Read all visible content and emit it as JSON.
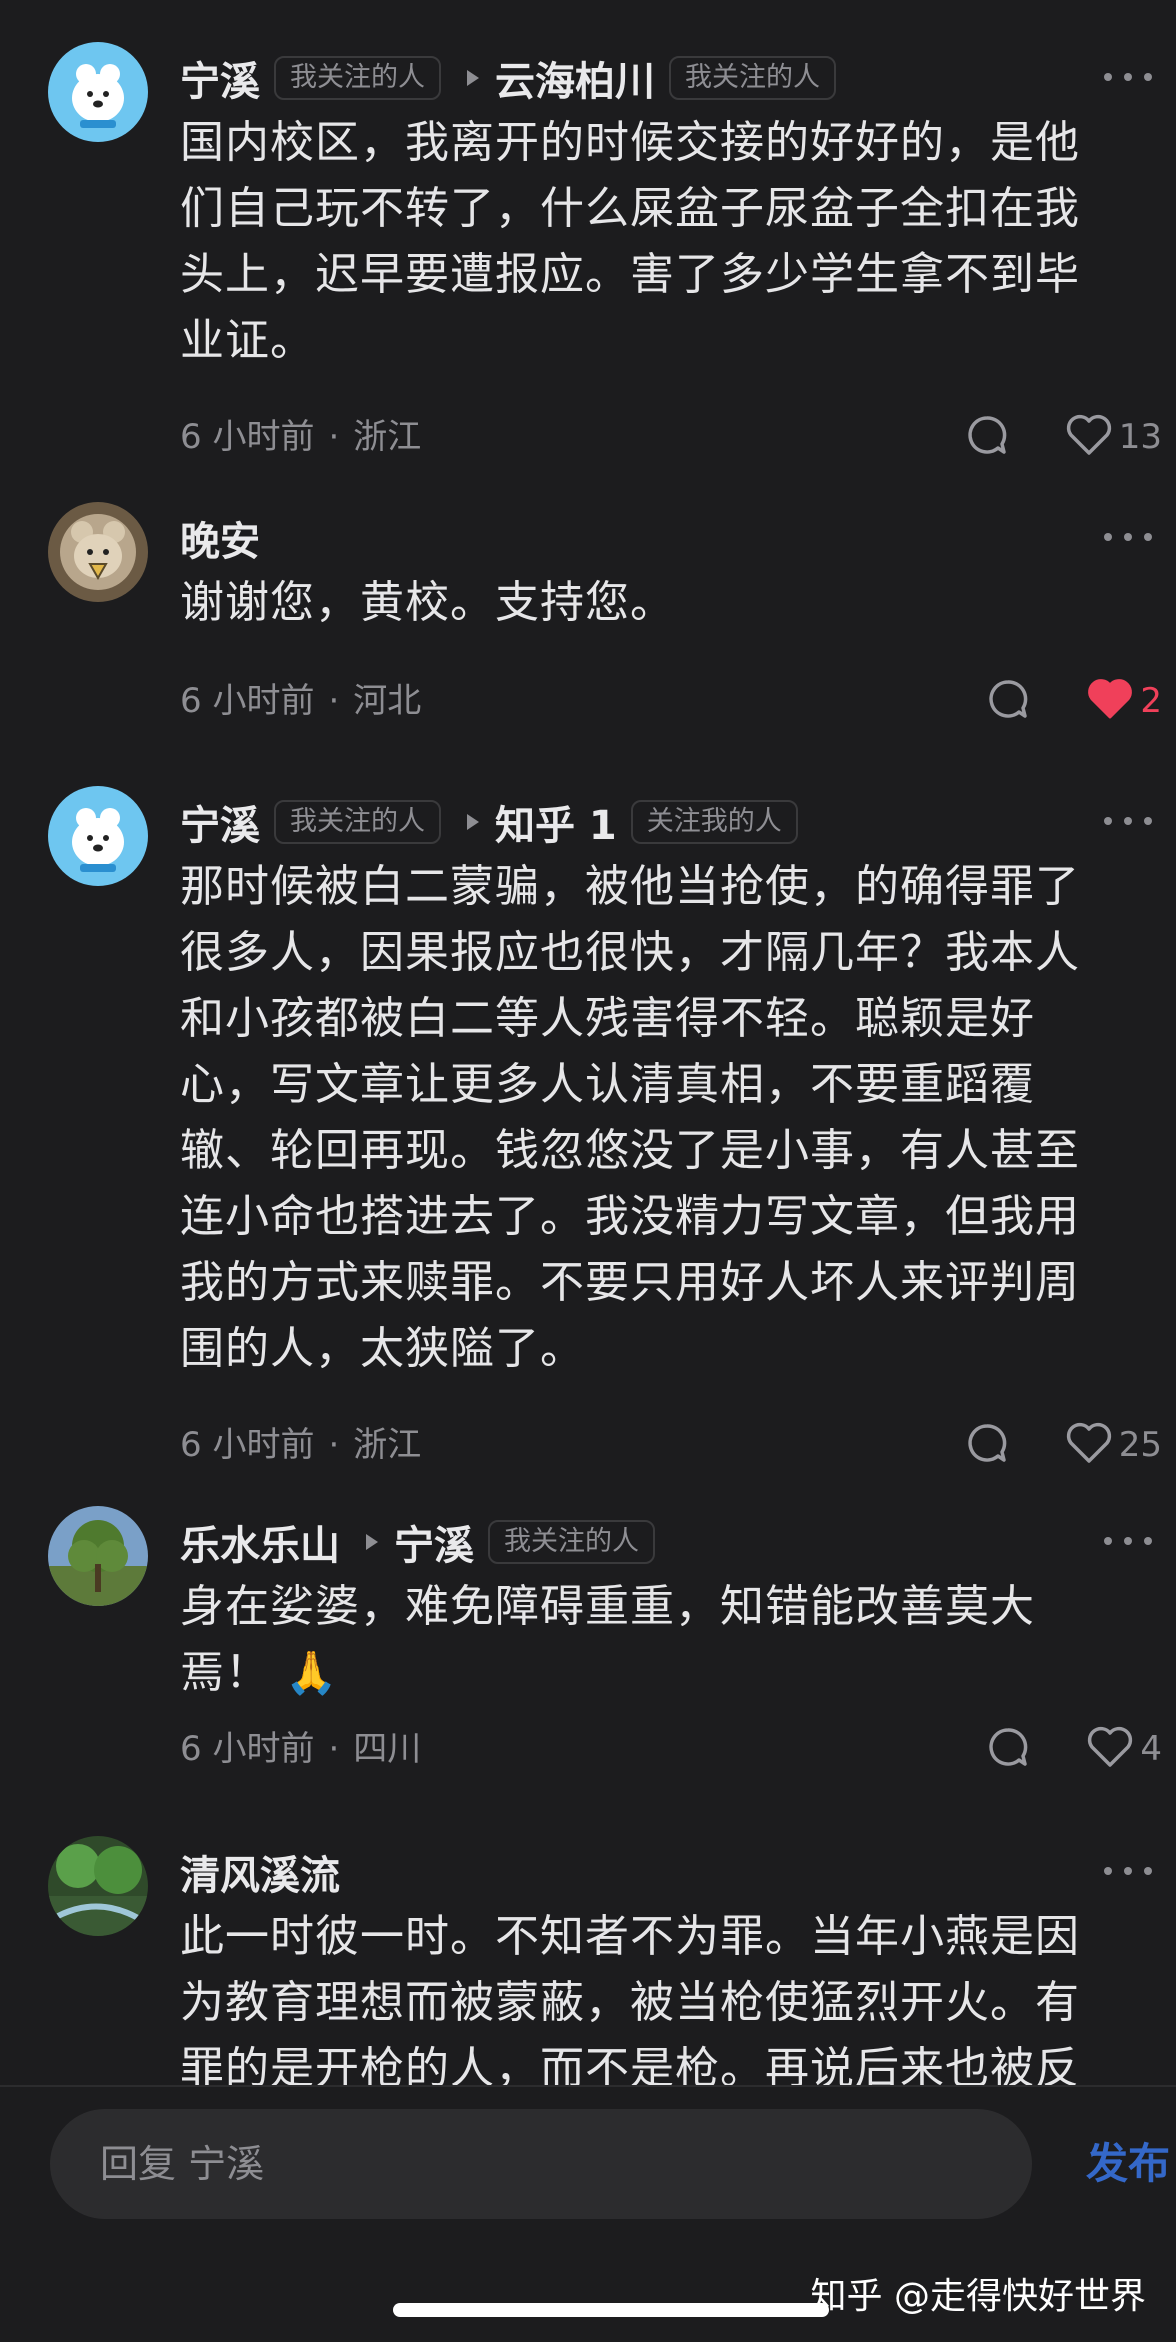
{
  "comments": [
    {
      "author": "宁溪",
      "author_tag": "我关注的人",
      "reply_to": "云海柏川",
      "reply_to_tag": "我关注的人",
      "lines": [
        "国内校区，我离开的时候交接的好好的，是他",
        "们自己玩不转了，什么屎盆子尿盆子全扣在我",
        "头上，迟早要遭报应。害了多少学生拿不到毕",
        "业证。"
      ],
      "time": "6 小时前",
      "location": "浙江",
      "likes": "13",
      "liked": false
    },
    {
      "author": "晚安",
      "lines": [
        "谢谢您，黄校。支持您。"
      ],
      "time": "6 小时前",
      "location": "河北",
      "likes": "2",
      "liked": true
    },
    {
      "author": "宁溪",
      "author_tag": "我关注的人",
      "reply_to": "知乎 1",
      "reply_to_tag": "关注我的人",
      "lines": [
        "那时候被白二蒙骗，被他当抢使，的确得罪了",
        "很多人，因果报应也很快，才隔几年？我本人",
        "和小孩都被白二等人残害得不轻。聪颖是好",
        "心，写文章让更多人认清真相，不要重蹈覆",
        "辙、轮回再现。钱忽悠没了是小事，有人甚至",
        "连小命也搭进去了。我没精力写文章，但我用",
        "我的方式来赎罪。不要只用好人坏人来评判周",
        "围的人，太狭隘了。"
      ],
      "time": "6 小时前",
      "location": "浙江",
      "likes": "25",
      "liked": false
    },
    {
      "author": "乐水乐山",
      "reply_to": "宁溪",
      "reply_to_tag": "我关注的人",
      "lines": [
        "身在娑婆，难免障碍重重，知错能改善莫大",
        "焉！"
      ],
      "emoji": "🙏",
      "time": "6 小时前",
      "location": "四川",
      "likes": "4",
      "liked": false
    },
    {
      "author": "清风溪流",
      "lines": [
        "此一时彼一时。不知者不为罪。当年小燕是因",
        "为教育理想而被蒙蔽，被当枪使猛烈开火。有",
        "罪的是开枪的人，而不是枪。再说后来也被反"
      ]
    }
  ],
  "reply_bar": {
    "placeholder": "回复 宁溪",
    "publish_label": "发布"
  },
  "watermark": "知乎 @走得快好世界",
  "colors": {
    "background": "#1c1c1e",
    "accent": "#3468c9",
    "liked": "#f0405a",
    "secondary_text": "#8e8e93"
  },
  "icons": {
    "more": "more-dots-icon",
    "reply": "comment-bubble-icon",
    "like": "heart-icon"
  }
}
